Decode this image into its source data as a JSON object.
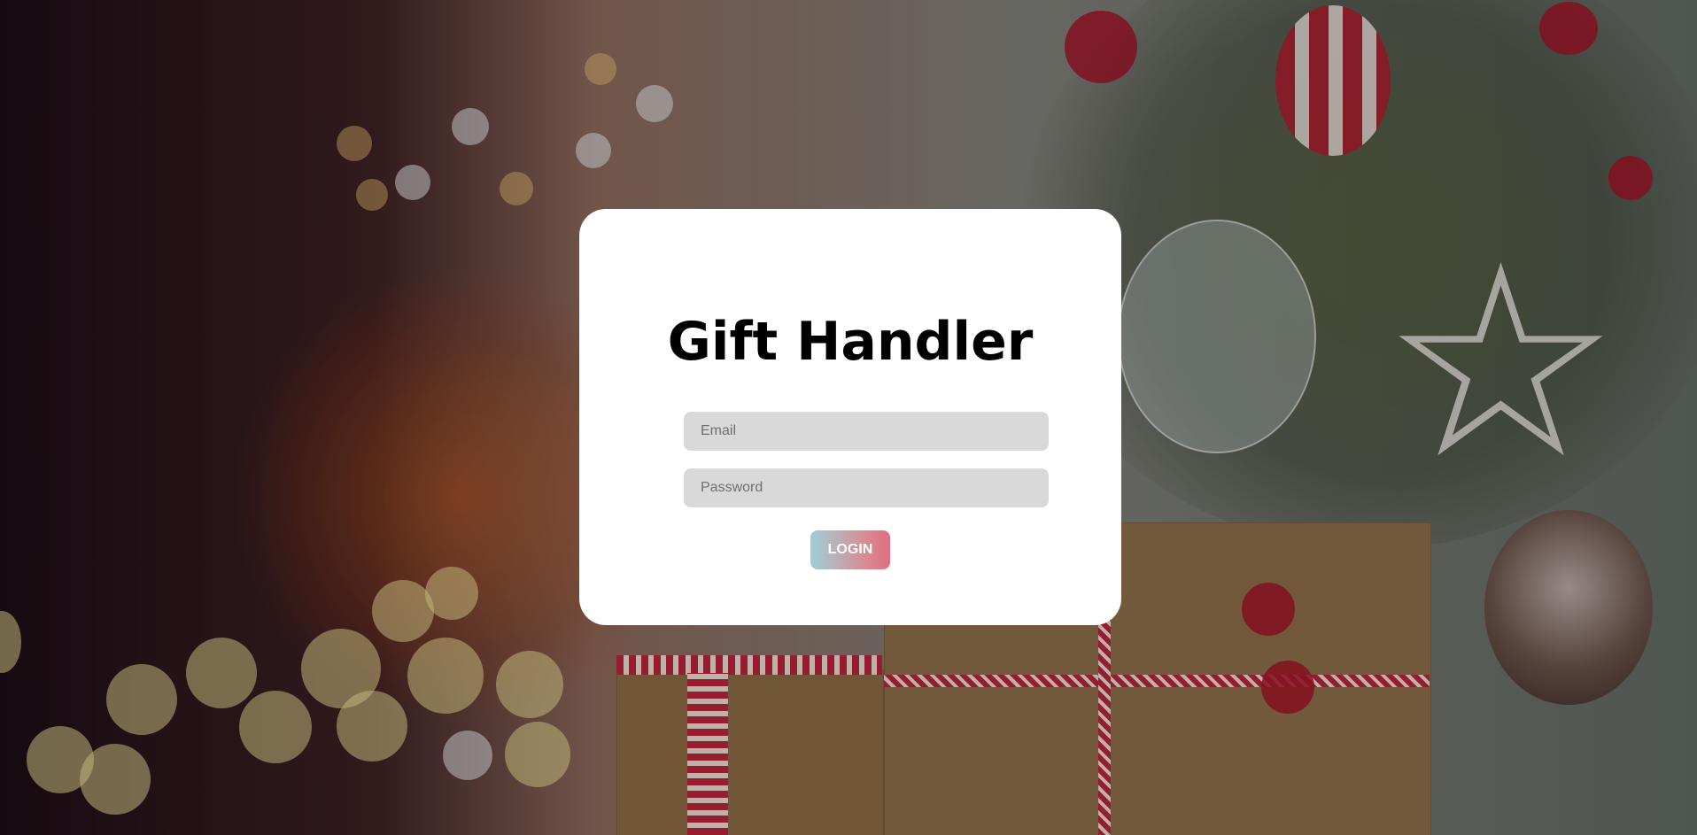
{
  "app": {
    "title": "Gift Handler"
  },
  "login_form": {
    "email_placeholder": "Email",
    "email_value": "",
    "password_placeholder": "Password",
    "password_value": "",
    "submit_label": "LOGIN"
  },
  "colors": {
    "card_background": "#ffffff",
    "field_background": "#d9d9d9",
    "button_gradient_start": "#9fd0d8",
    "button_gradient_end": "#dd6f80",
    "title_color": "#000000"
  }
}
